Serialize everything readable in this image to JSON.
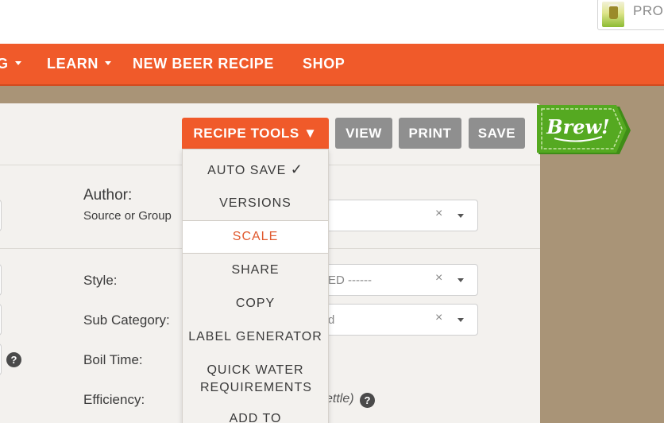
{
  "header": {
    "profile_label": "PROF"
  },
  "nav": {
    "items": [
      {
        "label": "G"
      },
      {
        "label": "LEARN"
      },
      {
        "label": "NEW BEER RECIPE"
      },
      {
        "label": "SHOP"
      }
    ]
  },
  "toolbar": {
    "recipe_tools_label": "RECIPE TOOLS ▼",
    "view_label": "VIEW",
    "print_label": "PRINT",
    "save_label": "SAVE"
  },
  "badge": {
    "brew_label": "Brew!"
  },
  "dropdown": {
    "items": [
      {
        "label": "AUTO SAVE",
        "suffix": "✓"
      },
      {
        "label": "VERSIONS"
      },
      {
        "label": "SCALE",
        "active": true
      },
      {
        "label": "SHARE"
      },
      {
        "label": "COPY"
      },
      {
        "label": "LABEL GENERATOR"
      },
      {
        "label": "QUICK WATER REQUIREMENTS"
      },
      {
        "label": "ADD TO"
      }
    ]
  },
  "form": {
    "author_label": "Author:",
    "author_sub": "Source or Group",
    "style_label": "Style:",
    "style_value": "ED ------",
    "sub_category_label": "Sub Category:",
    "sub_category_value": "d",
    "boil_time_label": "Boil Time:",
    "efficiency_label": "Efficiency:",
    "efficiency_note": "ettle)"
  },
  "colors": {
    "brand_orange": "#f05a2a",
    "button_grey": "#8f8f8f",
    "brew_green": "#55a921",
    "background": "#a99477",
    "panel": "#f3f1ee"
  },
  "icons": {
    "clear": "×",
    "help": "?"
  }
}
